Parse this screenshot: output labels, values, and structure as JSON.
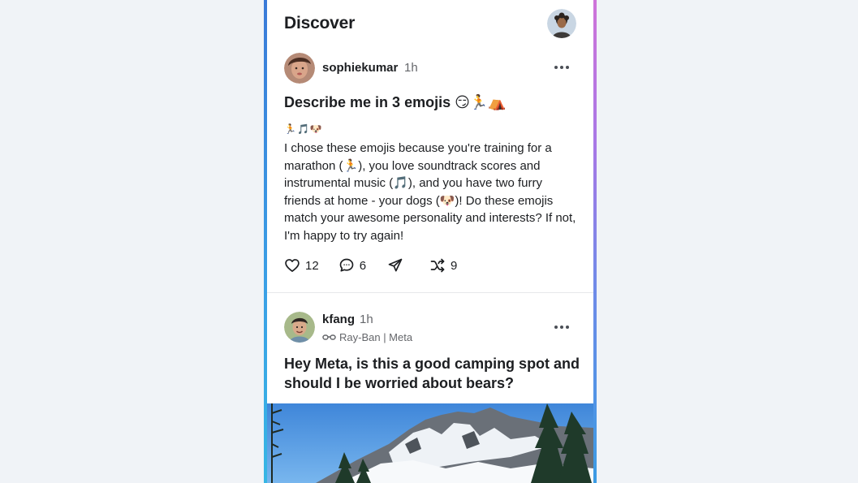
{
  "header": {
    "title": "Discover",
    "profile_avatar": "user-avatar"
  },
  "posts": [
    {
      "username": "sophiekumar",
      "time": "1h",
      "title": "Describe me in 3 emojis 😏🏃⛺",
      "emoji_line": "🏃🎵🐶",
      "body": "I chose these emojis because you're training for a marathon (🏃), you love soundtrack scores and instrumental music (🎵), and you have two furry friends at home - your dogs (🐶)! Do these emojis match your awesome personality and interests? If not, I'm happy to try again!",
      "likes": "12",
      "comments": "6",
      "shares": "9"
    },
    {
      "username": "kfang",
      "time": "1h",
      "device": "Ray-Ban | Meta",
      "title": "Hey Meta, is this a good camping spot and should I be worried about bears?"
    }
  ],
  "icons": {
    "more": "more-horizontal-icon",
    "like": "heart-icon",
    "comment": "comment-icon",
    "share": "send-icon",
    "remix": "shuffle-icon",
    "glasses": "glasses-icon"
  },
  "colors": {
    "frame_gradient_left": "#3aa0e6",
    "frame_gradient_right": "#cf74d9",
    "page_background": "#f0f3f7",
    "text_primary": "#1c1e21",
    "text_secondary": "#65676b"
  }
}
